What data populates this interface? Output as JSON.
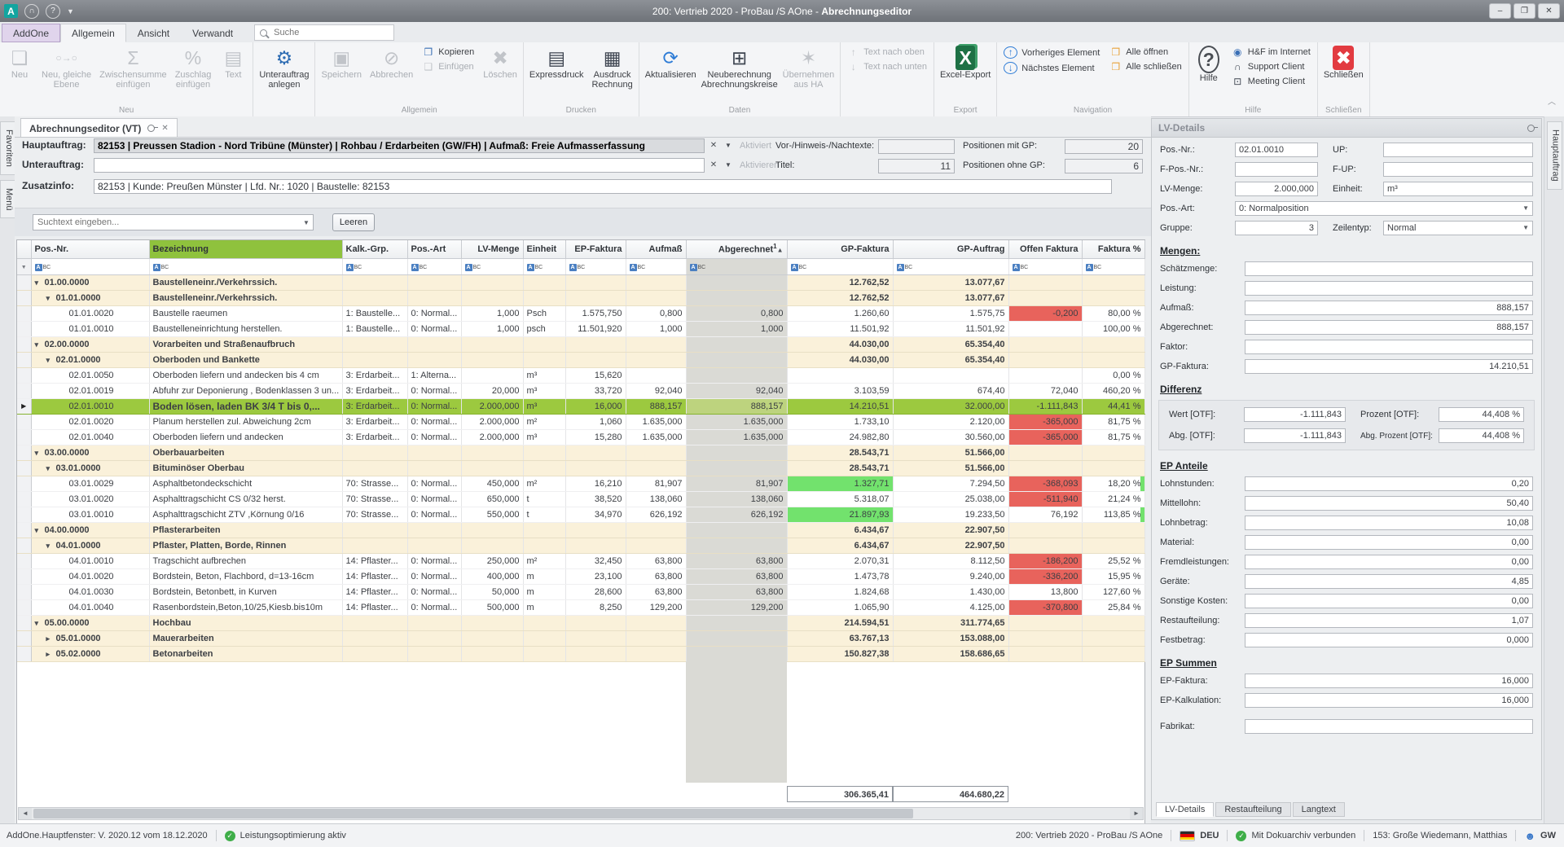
{
  "window": {
    "title_prefix": "200: Vertrieb 2020 - ProBau /S AOne - ",
    "title_module": "Abrechnungseditor",
    "controls": {
      "minimize": "‒",
      "maximize": "❐",
      "close": "✕"
    },
    "logo_letter": "A"
  },
  "ribbon_tabs": {
    "addone": "AddOne",
    "items": [
      "Allgemein",
      "Ansicht",
      "Verwandt"
    ],
    "active": "Allgemein",
    "search_placeholder": "Suche"
  },
  "ribbon_groups": [
    {
      "label": "Neu",
      "buttons": [
        {
          "n": "neu",
          "t": "Neu",
          "g": "❏",
          "d": 1
        },
        {
          "n": "neu-gleiche-ebene",
          "t": "Neu, gleiche\nEbene",
          "g": "○→○",
          "d": 1,
          "fs": 12
        },
        {
          "n": "zwischensumme-einfuegen",
          "t": "Zwischensumme\neinfügen",
          "g": "Σ",
          "d": 1
        },
        {
          "n": "zuschlag-einfuegen",
          "t": "Zuschlag\neinfügen",
          "g": "%",
          "d": 1
        },
        {
          "n": "text",
          "t": "Text",
          "g": "▤",
          "d": 1
        }
      ]
    },
    {
      "label": "",
      "buttons": [
        {
          "n": "unterauftrag-anlegen",
          "t": "Unterauftrag\nanlegen",
          "g": "⚙",
          "c": "#2f6db3"
        }
      ]
    },
    {
      "label": "Allgemein",
      "buttons": [
        {
          "n": "speichern",
          "t": "Speichern",
          "g": "▣",
          "d": 1
        },
        {
          "n": "abbrechen",
          "t": "Abbrechen",
          "g": "⊘",
          "d": 1
        },
        {
          "stack": [
            {
              "n": "kopieren",
              "t": "Kopieren",
              "g": "❐",
              "c": "#3a6fb5"
            },
            {
              "n": "einfuegen",
              "t": "Einfügen",
              "g": "❑",
              "d": 1
            }
          ]
        },
        {
          "n": "loeschen",
          "t": "Löschen",
          "g": "✖",
          "d": 1
        }
      ]
    },
    {
      "label": "Drucken",
      "buttons": [
        {
          "n": "expressdruck",
          "t": "Expressdruck",
          "g": "▤",
          "c": "#3d4450"
        },
        {
          "n": "ausdruck-rechnung",
          "t": "Ausdruck\nRechnung",
          "g": "▦",
          "c": "#3d4450"
        }
      ]
    },
    {
      "label": "Daten",
      "buttons": [
        {
          "n": "aktualisieren",
          "t": "Aktualisieren",
          "g": "⟳",
          "c": "#2e7cd6"
        },
        {
          "n": "neuberechnung-abrechnungskreise",
          "t": "Neuberechnung\nAbrechnungskreise",
          "g": "⊞",
          "c": "#3d4450"
        },
        {
          "n": "uebernehmen-aus-ha",
          "t": "Übernehmen\naus HA",
          "g": "✶",
          "d": 1
        }
      ]
    },
    {
      "label": "",
      "buttons": [
        {
          "stack": [
            {
              "n": "text-nach-oben",
              "t": "Text nach oben",
              "g": "↑",
              "d": 1
            },
            {
              "n": "text-nach-unten",
              "t": "Text nach unten",
              "g": "↓",
              "d": 1
            }
          ]
        }
      ]
    },
    {
      "label": "Export",
      "buttons": [
        {
          "n": "excel-export",
          "t": "Excel-Export",
          "g": "X",
          "st": "excel"
        }
      ]
    },
    {
      "label": "Navigation",
      "buttons": [
        {
          "stack": [
            {
              "n": "vorheriges-element",
              "t": "Vorheriges Element",
              "g": "↑",
              "st": "circ"
            },
            {
              "n": "naechstes-element",
              "t": "Nächstes Element",
              "g": "↓",
              "st": "circ"
            }
          ]
        },
        {
          "stack": [
            {
              "n": "alle-oeffnen",
              "t": "Alle öffnen",
              "g": "❒",
              "c": "#e8a33d"
            },
            {
              "n": "alle-schliessen",
              "t": "Alle schließen",
              "g": "❒",
              "c": "#e8a33d"
            }
          ]
        }
      ]
    },
    {
      "label": "Hilfe",
      "buttons": [
        {
          "n": "hilfe",
          "t": "Hilfe",
          "g": "?",
          "st": "help"
        },
        {
          "stack": [
            {
              "n": "hf-im-internet",
              "t": "H&F im Internet",
              "g": "◉",
              "c": "#3a6fb5"
            },
            {
              "n": "support-client",
              "t": "Support Client",
              "g": "∩",
              "c": "#3d4450"
            },
            {
              "n": "meeting-client",
              "t": "Meeting Client",
              "g": "⊡",
              "c": "#3d4450"
            }
          ]
        }
      ]
    },
    {
      "label": "Schließen",
      "buttons": [
        {
          "n": "schliessen",
          "t": "Schließen",
          "g": "✖",
          "st": "redx"
        }
      ]
    }
  ],
  "side_tabs": {
    "left": [
      "Favoriten",
      "Menü"
    ],
    "right": [
      "Hauptauftrag"
    ]
  },
  "doc_tab": {
    "label": "Abrechnungseditor (VT)"
  },
  "header_form": {
    "hauptauftrag_label": "Hauptauftrag:",
    "hauptauftrag_value": "82153 | Preussen Stadion - Nord Tribüne (Münster) | Rohbau / Erdarbeiten (GW/FH) | Aufmaß: Freie Aufmasserfassung",
    "hauptauftrag_action": "Aktiviert",
    "unterauftrag_label": "Unterauftrag:",
    "unterauftrag_value": "",
    "unterauftrag_action": "Aktivieren",
    "zusatzinfo_label": "Zusatzinfo:",
    "zusatzinfo_value": "82153 | Kunde: Preußen Münster | Lfd. Nr.: 1020 | Baustelle: 82153",
    "vortexte_label": "Vor-/Hinweis-/Nachtexte:",
    "vortexte_value": "",
    "titel_label": "Titel:",
    "titel_value": "11",
    "pos_mit_gp_label": "Positionen mit GP:",
    "pos_mit_gp_value": "20",
    "pos_ohne_gp_label": "Positionen ohne GP:",
    "pos_ohne_gp_value": "6"
  },
  "search_row": {
    "placeholder": "Suchtext eingeben...",
    "button": "Leeren"
  },
  "grid": {
    "columns": [
      "Pos.-Nr.",
      "Bezeichnung",
      "Kalk.-Grp.",
      "Pos.-Art",
      "LV-Menge",
      "Einheit",
      "EP-Faktura",
      "Aufmaß",
      "Abgerechnet",
      "GP-Faktura",
      "GP-Auftrag",
      "Offen Faktura",
      "Faktura %"
    ],
    "sort_column": "Abgerechnet",
    "sort_order": "1",
    "sort_dir": "▲",
    "rows": [
      {
        "l": 1,
        "e": "o",
        "pos": "01.00.0000",
        "name": "Baustelleneinr./Verkehrssich.",
        "gpf": "12.762,52",
        "gpa": "13.077,67"
      },
      {
        "l": 2,
        "e": "o",
        "pos": "01.01.0000",
        "name": "Baustelleneinr./Verkehrssich.",
        "gpf": "12.762,52",
        "gpa": "13.077,67"
      },
      {
        "l": 3,
        "pos": "01.01.0020",
        "name": "Baustelle raeumen",
        "kalk": "1: Baustelle...",
        "art": "0: Normal...",
        "mg": "1,000",
        "eh": "Psch",
        "ep": "1.575,750",
        "auf": "0,800",
        "abg": "0,800",
        "gpf": "1.260,60",
        "gpa": "1.575,75",
        "off": "-0,200",
        "r": 1,
        "pct": "80,00 %"
      },
      {
        "l": 3,
        "pos": "01.01.0010",
        "name": "Baustelleneinrichtung herstellen.",
        "kalk": "1: Baustelle...",
        "art": "0: Normal...",
        "mg": "1,000",
        "eh": "psch",
        "ep": "11.501,920",
        "auf": "1,000",
        "abg": "1,000",
        "gpf": "11.501,92",
        "gpa": "11.501,92",
        "off": "",
        "pct": "100,00 %"
      },
      {
        "l": 1,
        "e": "o",
        "pos": "02.00.0000",
        "name": "Vorarbeiten und Straßenaufbruch",
        "gpf": "44.030,00",
        "gpa": "65.354,40"
      },
      {
        "l": 2,
        "e": "o",
        "pos": "02.01.0000",
        "name": "Oberboden und Bankette",
        "gpf": "44.030,00",
        "gpa": "65.354,40"
      },
      {
        "l": 3,
        "pos": "02.01.0050",
        "name": "Oberboden liefern und andecken bis 4 cm",
        "kalk": "3: Erdarbeit...",
        "art": "1: Alterna...",
        "mg": "",
        "eh": "m³",
        "ep": "15,620",
        "auf": "",
        "abg": "",
        "gpf": "",
        "gpa": "",
        "off": "",
        "pct": "0,00 %"
      },
      {
        "l": 3,
        "pos": "02.01.0019",
        "name": "Abfuhr zur Deponierung , Bodenklassen 3 un...",
        "kalk": "3: Erdarbeit...",
        "art": "0: Normal...",
        "mg": "20,000",
        "eh": "m³",
        "ep": "33,720",
        "auf": "92,040",
        "abg": "92,040",
        "gpf": "3.103,59",
        "gpa": "674,40",
        "off": "72,040",
        "pct": "460,20 %"
      },
      {
        "l": 3,
        "sel": 1,
        "pos": "02.01.0010",
        "name": "Boden lösen, laden BK 3/4 T bis 0,...",
        "kalk": "3: Erdarbeit...",
        "art": "0: Normal...",
        "mg": "2.000,000",
        "eh": "m³",
        "ep": "16,000",
        "auf": "888,157",
        "abg": "888,157",
        "gpf": "14.210,51",
        "gpa": "32.000,00",
        "off": "-1.111,843",
        "pct": "44,41 %"
      },
      {
        "l": 3,
        "pos": "02.01.0020",
        "name": "Planum herstellen zul. Abweichung 2cm",
        "kalk": "3: Erdarbeit...",
        "art": "0: Normal...",
        "mg": "2.000,000",
        "eh": "m²",
        "ep": "1,060",
        "auf": "1.635,000",
        "abg": "1.635,000",
        "gpf": "1.733,10",
        "gpa": "2.120,00",
        "off": "-365,000",
        "r": 1,
        "pct": "81,75 %"
      },
      {
        "l": 3,
        "pos": "02.01.0040",
        "name": "Oberboden liefern und andecken",
        "kalk": "3: Erdarbeit...",
        "art": "0: Normal...",
        "mg": "2.000,000",
        "eh": "m³",
        "ep": "15,280",
        "auf": "1.635,000",
        "abg": "1.635,000",
        "gpf": "24.982,80",
        "gpa": "30.560,00",
        "off": "-365,000",
        "r": 1,
        "pct": "81,75 %"
      },
      {
        "l": 1,
        "e": "o",
        "pos": "03.00.0000",
        "name": "Oberbauarbeiten",
        "gpf": "28.543,71",
        "gpa": "51.566,00"
      },
      {
        "l": 2,
        "e": "o",
        "pos": "03.01.0000",
        "name": "Bituminöser Oberbau",
        "gpf": "28.543,71",
        "gpa": "51.566,00"
      },
      {
        "l": 3,
        "pos": "03.01.0029",
        "name": "Asphaltbetondeckschicht",
        "kalk": "70: Strasse...",
        "art": "0: Normal...",
        "mg": "450,000",
        "eh": "m²",
        "ep": "16,210",
        "auf": "81,907",
        "abg": "81,907",
        "gpf": "1.327,71",
        "g": 1,
        "gpa": "7.294,50",
        "off": "-368,093",
        "r": 1,
        "pct": "18,20 %",
        "t": 1
      },
      {
        "l": 3,
        "pos": "03.01.0020",
        "name": "Asphalttragschicht CS 0/32 herst.",
        "kalk": "70: Strasse...",
        "art": "0: Normal...",
        "mg": "650,000",
        "eh": "t",
        "ep": "38,520",
        "auf": "138,060",
        "abg": "138,060",
        "gpf": "5.318,07",
        "gpa": "25.038,00",
        "off": "-511,940",
        "r": 1,
        "pct": "21,24 %"
      },
      {
        "l": 3,
        "pos": "03.01.0010",
        "name": "Asphalttragschicht ZTV ,Körnung 0/16",
        "kalk": "70: Strasse...",
        "art": "0: Normal...",
        "mg": "550,000",
        "eh": "t",
        "ep": "34,970",
        "auf": "626,192",
        "abg": "626,192",
        "gpf": "21.897,93",
        "g": 1,
        "gpa": "19.233,50",
        "off": "76,192",
        "pct": "113,85 %",
        "t": 1
      },
      {
        "l": 1,
        "e": "o",
        "pos": "04.00.0000",
        "name": "Pflasterarbeiten",
        "gpf": "6.434,67",
        "gpa": "22.907,50"
      },
      {
        "l": 2,
        "e": "o",
        "pos": "04.01.0000",
        "name": "Pflaster, Platten, Borde, Rinnen",
        "gpf": "6.434,67",
        "gpa": "22.907,50"
      },
      {
        "l": 3,
        "pos": "04.01.0010",
        "name": "Tragschicht aufbrechen",
        "kalk": "14: Pflaster...",
        "art": "0: Normal...",
        "mg": "250,000",
        "eh": "m²",
        "ep": "32,450",
        "auf": "63,800",
        "abg": "63,800",
        "gpf": "2.070,31",
        "gpa": "8.112,50",
        "off": "-186,200",
        "r": 1,
        "pct": "25,52 %"
      },
      {
        "l": 3,
        "pos": "04.01.0020",
        "name": "Bordstein, Beton, Flachbord, d=13-16cm",
        "kalk": "14: Pflaster...",
        "art": "0: Normal...",
        "mg": "400,000",
        "eh": "m",
        "ep": "23,100",
        "auf": "63,800",
        "abg": "63,800",
        "gpf": "1.473,78",
        "gpa": "9.240,00",
        "off": "-336,200",
        "r": 1,
        "pct": "15,95 %"
      },
      {
        "l": 3,
        "pos": "04.01.0030",
        "name": "Bordstein, Betonbett, in Kurven",
        "kalk": "14: Pflaster...",
        "art": "0: Normal...",
        "mg": "50,000",
        "eh": "m",
        "ep": "28,600",
        "auf": "63,800",
        "abg": "63,800",
        "gpf": "1.824,68",
        "gpa": "1.430,00",
        "off": "13,800",
        "pct": "127,60 %"
      },
      {
        "l": 3,
        "pos": "04.01.0040",
        "name": "Rasenbordstein,Beton,10/25,Kiesb.bis10m",
        "kalk": "14: Pflaster...",
        "art": "0: Normal...",
        "mg": "500,000",
        "eh": "m",
        "ep": "8,250",
        "auf": "129,200",
        "abg": "129,200",
        "gpf": "1.065,90",
        "gpa": "4.125,00",
        "off": "-370,800",
        "r": 1,
        "pct": "25,84 %"
      },
      {
        "l": 1,
        "e": "o",
        "pos": "05.00.0000",
        "name": "Hochbau",
        "gpf": "214.594,51",
        "gpa": "311.774,65"
      },
      {
        "l": 2,
        "e": "c",
        "pos": "05.01.0000",
        "name": "Mauerarbeiten",
        "gpf": "63.767,13",
        "gpa": "153.088,00"
      },
      {
        "l": 2,
        "e": "c",
        "pos": "05.02.0000",
        "name": "Betonarbeiten",
        "gpf": "150.827,38",
        "gpa": "158.686,65"
      }
    ],
    "totals": {
      "gp_faktura": "306.365,41",
      "gp_auftrag": "464.680,22"
    }
  },
  "lv_panel": {
    "title": "LV-Details",
    "fields": {
      "pos_nr_label": "Pos.-Nr.:",
      "pos_nr": "02.01.0010",
      "up_label": "UP:",
      "up": "",
      "f_pos_nr_label": "F-Pos.-Nr.:",
      "f_pos_nr": "",
      "f_up_label": "F-UP:",
      "f_up": "",
      "lv_menge_label": "LV-Menge:",
      "lv_menge": "2.000,000",
      "einheit_label": "Einheit:",
      "einheit": "m³",
      "pos_art_label": "Pos.-Art:",
      "pos_art": "0: Normalposition",
      "gruppe_label": "Gruppe:",
      "gruppe": "3",
      "zeilentyp_label": "Zeilentyp:",
      "zeilentyp": "Normal"
    },
    "mengen": {
      "title": "Mengen:",
      "schaetzmenge_label": "Schätzmenge:",
      "schaetzmenge": "",
      "leistung_label": "Leistung:",
      "leistung": "",
      "aufmass_label": "Aufmaß:",
      "aufmass": "888,157",
      "abgerechnet_label": "Abgerechnet:",
      "abgerechnet": "888,157",
      "faktor_label": "Faktor:",
      "faktor": "",
      "gp_faktura_label": "GP-Faktura:",
      "gp_faktura": "14.210,51"
    },
    "differenz": {
      "title": "Differenz",
      "wert_label": "Wert [OTF]:",
      "wert": "-1.111,843",
      "prozent_label": "Prozent [OTF]:",
      "prozent": "44,408 %",
      "abg_label": "Abg. [OTF]:",
      "abg": "-1.111,843",
      "abg_prozent_label": "Abg. Prozent [OTF]:",
      "abg_prozent": "44,408 %"
    },
    "ep_anteile": {
      "title": "EP Anteile",
      "rows": [
        [
          "Lohnstunden:",
          "0,20"
        ],
        [
          "Mittellohn:",
          "50,40"
        ],
        [
          "Lohnbetrag:",
          "10,08"
        ],
        [
          "Material:",
          "0,00"
        ],
        [
          "Fremdleistungen:",
          "0,00"
        ],
        [
          "Geräte:",
          "4,85"
        ],
        [
          "Sonstige Kosten:",
          "0,00"
        ],
        [
          "Restaufteilung:",
          "1,07"
        ],
        [
          "Festbetrag:",
          "0,000"
        ]
      ]
    },
    "ep_summen": {
      "title": "EP Summen",
      "rows": [
        [
          "EP-Faktura:",
          "16,000"
        ],
        [
          "EP-Kalkulation:",
          "16,000"
        ]
      ]
    },
    "fabrikat_label": "Fabrikat:",
    "fabrikat": "",
    "tabs": [
      "LV-Details",
      "Restaufteilung",
      "Langtext"
    ],
    "active_tab": "LV-Details"
  },
  "statusbar": {
    "left_text": "AddOne.Hauptfenster: V. 2020.12 vom 18.12.2020",
    "left_status": "Leistungsoptimierung aktiv",
    "right_app": "200: Vertrieb 2020 - ProBau /S AOne",
    "language": "DEU",
    "doku": "Mit Dokuarchiv verbunden",
    "user": "153: Große Wiedemann, Matthias",
    "user_initials": "GW"
  },
  "colors": {
    "selected_row": "#9cc93f",
    "group_row": "#faf1da",
    "abgerechnet_column": "#dadad5",
    "negative_cell": "#e8635c",
    "positive_cell": "#72e26d",
    "header_bezeichnung": "#8fc23d",
    "addone_tab": "#e0d4ec",
    "excel_green": "#1e7145",
    "close_red": "#e23b41",
    "status_green": "#3fae49"
  }
}
